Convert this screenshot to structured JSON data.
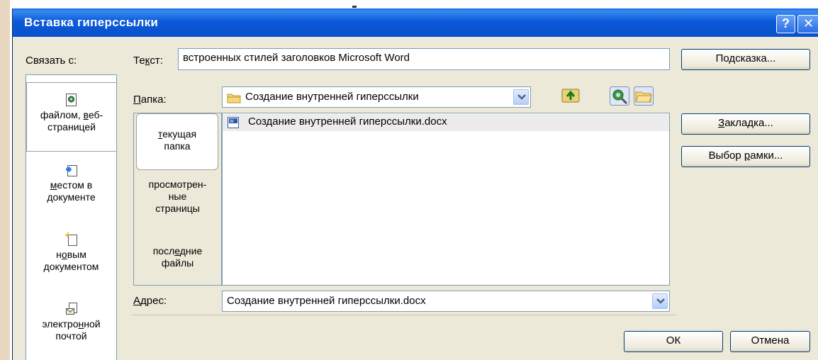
{
  "window": {
    "title": "Вставка гиперссылки",
    "help_glyph": "?",
    "close_glyph": "✕"
  },
  "link_with": {
    "label": "Связать с:",
    "items": [
      {
        "pre": "файлом, ",
        "u": "в",
        "post": "еб-\nстраницей"
      },
      {
        "pre": "",
        "u": "м",
        "post": "естом в\nдокументе"
      },
      {
        "pre": "н",
        "u": "о",
        "post": "вым\nдокументом"
      },
      {
        "pre": "электро",
        "u": "н",
        "post": "ной\nпочтой"
      }
    ]
  },
  "text_field": {
    "label_pre": "Те",
    "label_u": "к",
    "label_post": "ст:",
    "value": "встроенных стилей заголовков Microsoft Word"
  },
  "folder": {
    "label_pre": "",
    "label_u": "П",
    "label_post": "апка:",
    "value": "Создание внутренней гиперссылки"
  },
  "tabs": [
    {
      "pre": "",
      "u": "т",
      "post": "екущая\nпапка"
    },
    {
      "pre": "просмотрен-\nные\nстраницы",
      "u": "",
      "post": ""
    },
    {
      "pre": "посл",
      "u": "е",
      "post": "дние\nфайлы"
    }
  ],
  "files": [
    "Создание внутренней гиперссылки.docx"
  ],
  "address": {
    "label_pre": "",
    "label_u": "А",
    "label_post": "дрес:",
    "value": "Создание внутренней гиперссылки.docx"
  },
  "buttons": {
    "hint": {
      "pre": "По",
      "u": "д",
      "post": "сказка..."
    },
    "bookmark": {
      "pre": "",
      "u": "З",
      "post": "акладка..."
    },
    "frame": {
      "pre": "Выбор ",
      "u": "р",
      "post": "амки..."
    },
    "ok": "ОК",
    "cancel": "Отмена"
  }
}
